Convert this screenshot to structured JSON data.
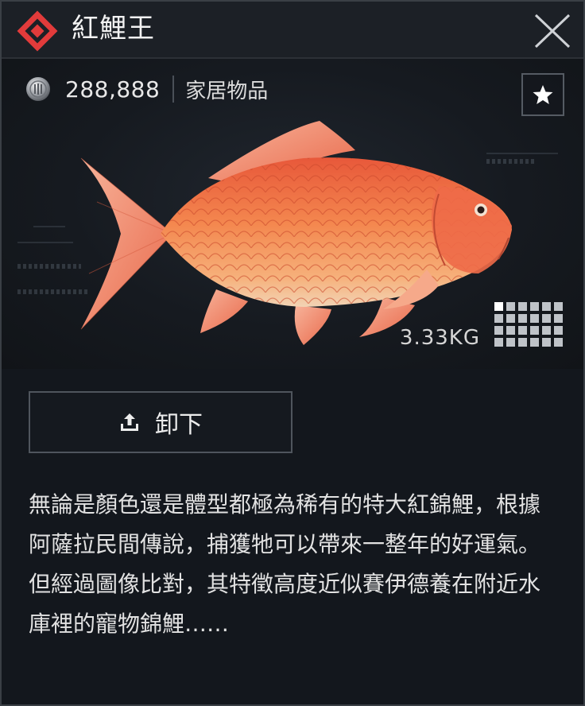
{
  "header": {
    "title": "紅鯉王",
    "logo_icon": "red-diamond-emblem-icon",
    "close_icon": "close-icon"
  },
  "item": {
    "price": "288,888",
    "category": "家居物品",
    "weight": "3.33KG",
    "coin_icon": "coin-icon",
    "favorite_icon": "star-icon",
    "size_icon": "inventory-grid-icon",
    "image": "red-carp-fish-image"
  },
  "actions": {
    "unload_label": "卸下",
    "unload_icon": "upload-icon"
  },
  "description": {
    "paragraph_1": "無論是顏色還是體型都極為稀有的特大紅錦鯉，根據阿薩拉民間傳說，捕獲牠可以帶來一整年的好運氣。",
    "paragraph_2": "但經過圖像比對，其特徵高度近似賽伊德養在附近水庫裡的寵物錦鯉……"
  },
  "colors": {
    "accent_red": "#e23b3b",
    "fish_orange": "#f07a45",
    "panel_bg": "#13171d",
    "text": "#e2e2e2"
  }
}
